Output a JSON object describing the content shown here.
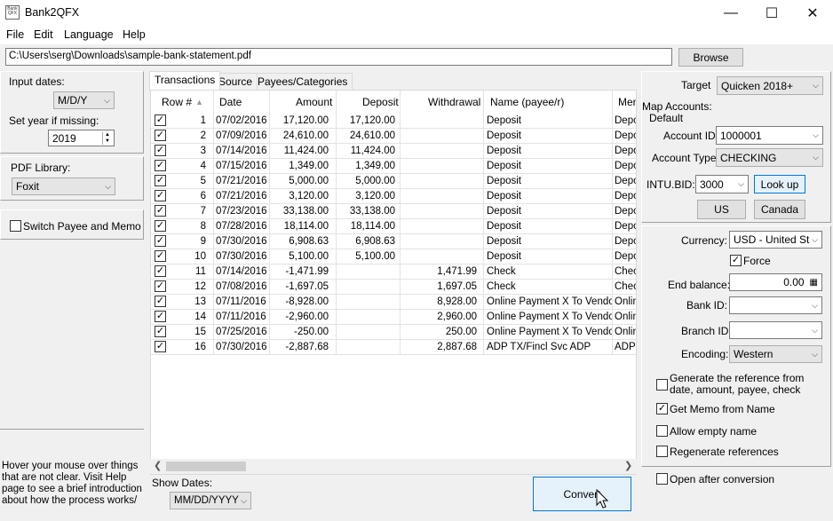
{
  "window": {
    "title": "Bank2QFX",
    "app_icon_text": "Bank QFX",
    "controls": {
      "minimize": "—",
      "maximize": "☐",
      "close": "✕"
    }
  },
  "menu": [
    "File",
    "Edit",
    "Language",
    "Help"
  ],
  "path": {
    "value": "C:\\Users\\serg\\Downloads\\sample-bank-statement.pdf",
    "browse_label": "Browse"
  },
  "left": {
    "input_dates_label": "Input dates:",
    "input_dates_value": "M/D/Y",
    "year_label": "Set year if missing:",
    "year_value": "2019",
    "pdf_library_label": "PDF Library:",
    "pdf_library_value": "Foxit",
    "switch_payee_memo_label": "Switch Payee and Memo",
    "switch_payee_memo_checked": false,
    "help_text": "Hover your mouse over things that are not clear. Visit Help page to see a brief introduction about how the process works/"
  },
  "tabs": [
    "Transactions",
    "Source",
    "Payees/Categories"
  ],
  "grid": {
    "columns": [
      "Row #",
      "Date",
      "Amount",
      "Deposit",
      "Withdrawal",
      "Name (payee/r)",
      "Mem"
    ],
    "rows": [
      {
        "n": "1",
        "date": "07/02/2016",
        "amount": "17,120.00",
        "deposit": "17,120.00",
        "withdrawal": "",
        "name": "Deposit",
        "memo": "Depo"
      },
      {
        "n": "2",
        "date": "07/09/2016",
        "amount": "24,610.00",
        "deposit": "24,610.00",
        "withdrawal": "",
        "name": "Deposit",
        "memo": "Depo"
      },
      {
        "n": "3",
        "date": "07/14/2016",
        "amount": "11,424.00",
        "deposit": "11,424.00",
        "withdrawal": "",
        "name": "Deposit",
        "memo": "Depo"
      },
      {
        "n": "4",
        "date": "07/15/2016",
        "amount": "1,349.00",
        "deposit": "1,349.00",
        "withdrawal": "",
        "name": "Deposit",
        "memo": "Depo"
      },
      {
        "n": "5",
        "date": "07/21/2016",
        "amount": "5,000.00",
        "deposit": "5,000.00",
        "withdrawal": "",
        "name": "Deposit",
        "memo": "Depo"
      },
      {
        "n": "6",
        "date": "07/21/2016",
        "amount": "3,120.00",
        "deposit": "3,120.00",
        "withdrawal": "",
        "name": "Deposit",
        "memo": "Depo"
      },
      {
        "n": "7",
        "date": "07/23/2016",
        "amount": "33,138.00",
        "deposit": "33,138.00",
        "withdrawal": "",
        "name": "Deposit",
        "memo": "Depo"
      },
      {
        "n": "8",
        "date": "07/28/2016",
        "amount": "18,114.00",
        "deposit": "18,114.00",
        "withdrawal": "",
        "name": "Deposit",
        "memo": "Depo"
      },
      {
        "n": "9",
        "date": "07/30/2016",
        "amount": "6,908.63",
        "deposit": "6,908.63",
        "withdrawal": "",
        "name": "Deposit",
        "memo": "Depo"
      },
      {
        "n": "10",
        "date": "07/30/2016",
        "amount": "5,100.00",
        "deposit": "5,100.00",
        "withdrawal": "",
        "name": "Deposit",
        "memo": "Depo"
      },
      {
        "n": "11",
        "date": "07/14/2016",
        "amount": "-1,471.99",
        "deposit": "",
        "withdrawal": "1,471.99",
        "name": "Check",
        "memo": "Chec"
      },
      {
        "n": "12",
        "date": "07/08/2016",
        "amount": "-1,697.05",
        "deposit": "",
        "withdrawal": "1,697.05",
        "name": "Check",
        "memo": "Chec"
      },
      {
        "n": "13",
        "date": "07/11/2016",
        "amount": "-8,928.00",
        "deposit": "",
        "withdrawal": "8,928.00",
        "name": "Online Payment X To Vendor",
        "memo": "Onlin"
      },
      {
        "n": "14",
        "date": "07/11/2016",
        "amount": "-2,960.00",
        "deposit": "",
        "withdrawal": "2,960.00",
        "name": "Online Payment X To Vendor",
        "memo": "Onlin"
      },
      {
        "n": "15",
        "date": "07/25/2016",
        "amount": "-250.00",
        "deposit": "",
        "withdrawal": "250.00",
        "name": "Online Payment X To Vendor",
        "memo": "Onlin"
      },
      {
        "n": "16",
        "date": "07/30/2016",
        "amount": "-2,887.68",
        "deposit": "",
        "withdrawal": "2,887.68",
        "name": "ADP TX/Fincl Svc ADP",
        "memo": "ADP T"
      }
    ]
  },
  "bottom": {
    "show_dates_label": "Show Dates:",
    "show_dates_value": "MM/DD/YYYY",
    "convert_label": "Convert"
  },
  "right": {
    "target_label": "Target",
    "target_value": "Quicken 2018+",
    "map_accounts_label": "Map Accounts:",
    "default_label": "Default",
    "account_id_label": "Account ID:",
    "account_id_value": "1000001",
    "account_type_label": "Account Type:",
    "account_type_value": "CHECKING",
    "intu_bid_label": "INTU.BID:",
    "intu_bid_value": "3000",
    "lookup_label": "Look up",
    "us_label": "US",
    "canada_label": "Canada",
    "currency_label": "Currency:",
    "currency_value": "USD - United Sta",
    "force_label": "Force",
    "end_balance_label": "End balance:",
    "end_balance_value": "0.00",
    "bank_id_label": "Bank ID:",
    "branch_id_label": "Branch ID",
    "encoding_label": "Encoding:",
    "encoding_value": "Western",
    "generate_ref_label": "Generate the reference from date, amount, payee, check",
    "get_memo_label": "Get Memo from Name",
    "allow_empty_label": "Allow empty name",
    "regenerate_label": "Regenerate references",
    "open_after_label": "Open after conversion"
  },
  "checks": {
    "force": true,
    "generate_ref": false,
    "get_memo": true,
    "allow_empty": false,
    "regenerate": false,
    "open_after": false
  }
}
